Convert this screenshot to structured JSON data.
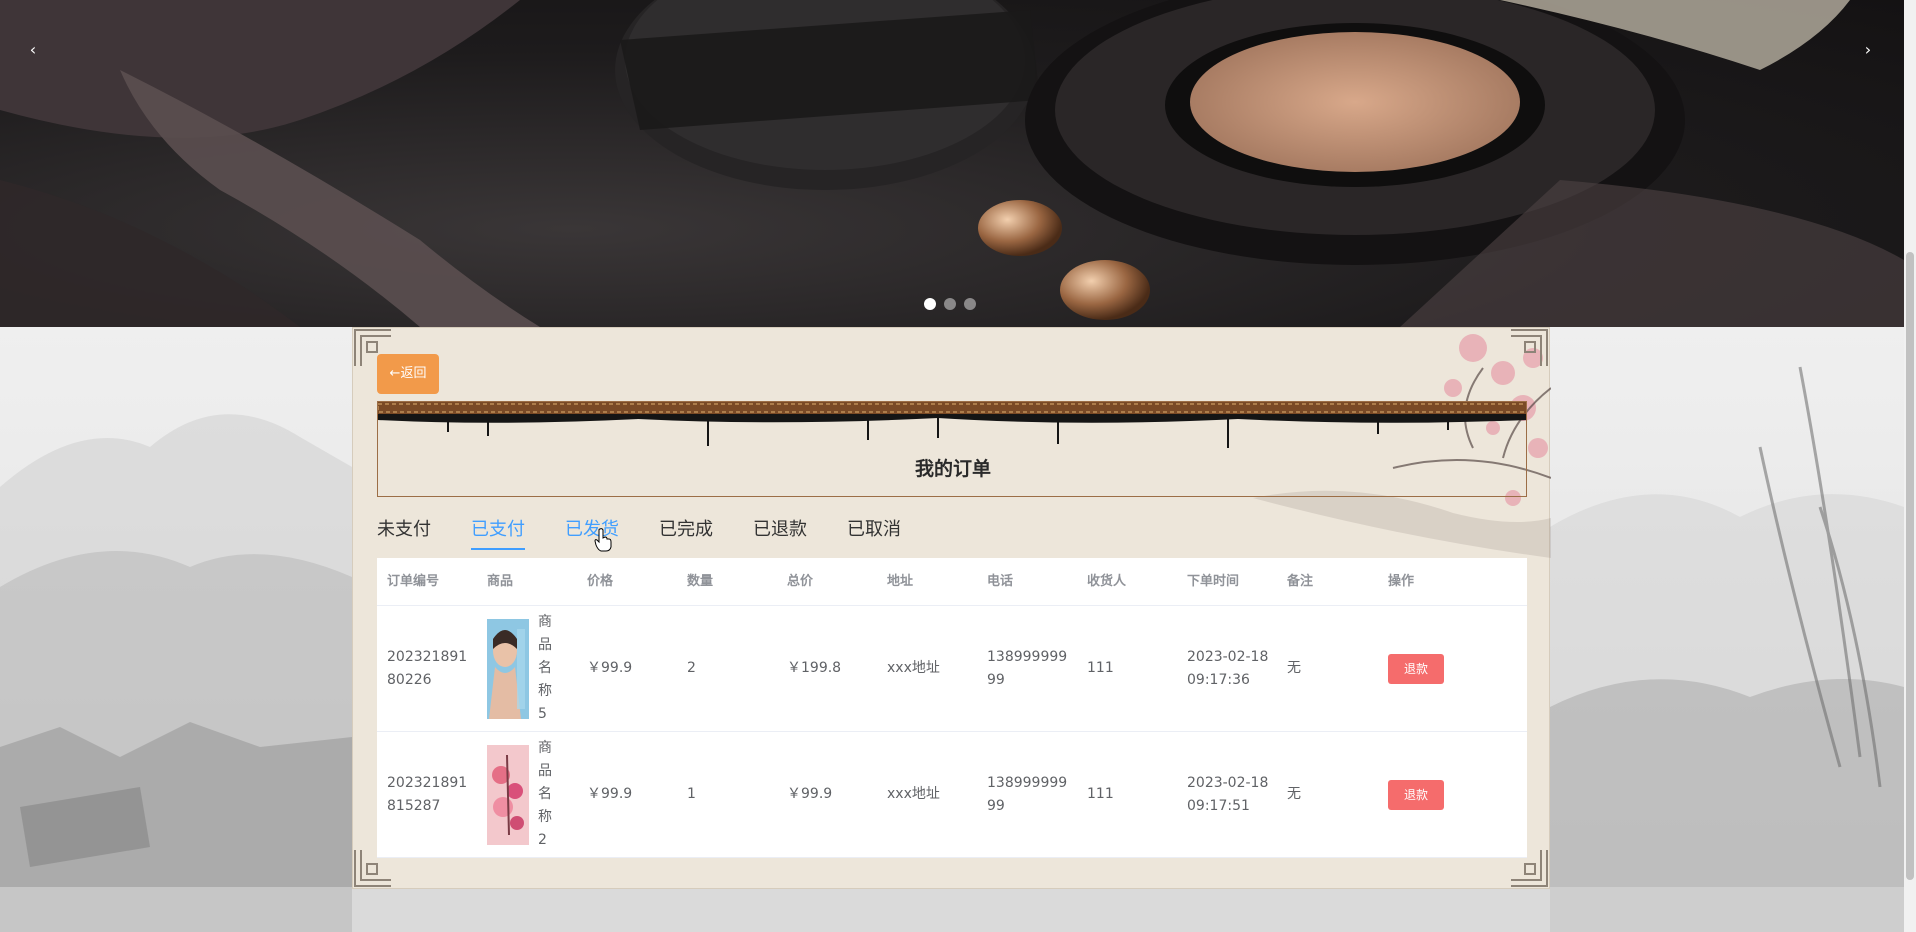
{
  "carousel": {
    "prev_label": "‹",
    "next_label": "›",
    "slide_count": 3,
    "active_slide": 1
  },
  "panel": {
    "back_label": "←返回",
    "title": "我的订单"
  },
  "tabs": [
    {
      "label": "未支付",
      "state": "normal"
    },
    {
      "label": "已支付",
      "state": "active"
    },
    {
      "label": "已发货",
      "state": "hover"
    },
    {
      "label": "已完成",
      "state": "normal"
    },
    {
      "label": "已退款",
      "state": "normal"
    },
    {
      "label": "已取消",
      "state": "normal"
    }
  ],
  "table": {
    "headers": [
      "订单编号",
      "商品",
      "价格",
      "数量",
      "总价",
      "地址",
      "电话",
      "收货人",
      "下单时间",
      "备注",
      "操作"
    ],
    "rows": [
      {
        "order_no": "202321891 80226",
        "goods_name": "商品名称5",
        "price": "￥99.9",
        "quantity": "2",
        "total": "￥199.8",
        "address": "xxx地址",
        "phone": "138999999 99",
        "receiver": "111",
        "order_time": "2023-02-18 09:17:36",
        "note": "无",
        "action": "退款"
      },
      {
        "order_no": "202321891 815287",
        "goods_name": "商品名称2",
        "price": "￥99.9",
        "quantity": "1",
        "total": "￥99.9",
        "address": "xxx地址",
        "phone": "138999999 99",
        "receiver": "111",
        "order_time": "2023-02-18 09:17:51",
        "note": "无",
        "action": "退款"
      }
    ]
  },
  "colors": {
    "accent": "#409eff",
    "back_button": "#f29a4a",
    "refund_button": "#f56c6c",
    "panel_bg": "#ede6da"
  }
}
